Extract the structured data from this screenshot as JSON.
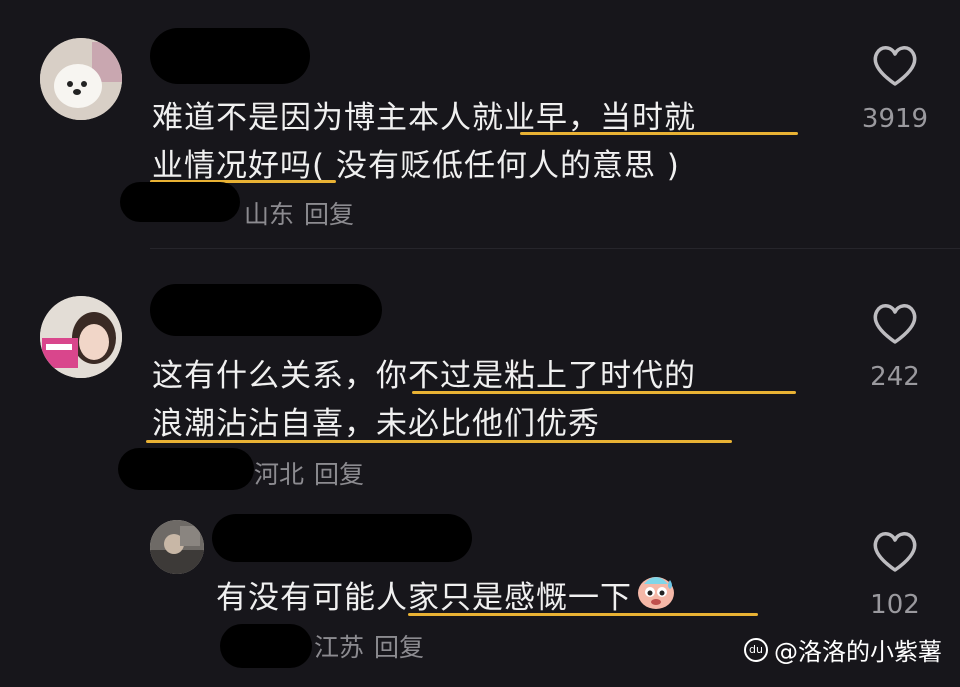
{
  "comments": [
    {
      "text_line1": "难道不是因为博主本人就业早，当时就",
      "text_line2": "业情况好吗( 没有贬低任何人的意思 )",
      "location": "山东",
      "reply": "回复",
      "likes": "3919"
    },
    {
      "text_line1": "这有什么关系，你不过是粘上了时代的",
      "text_line2": "浪潮沾沾自喜，未必比他们优秀",
      "location": "河北",
      "reply": "回复",
      "likes": "242"
    },
    {
      "text_line1": "有没有可能人家只是感慨一下",
      "location": "江苏",
      "reply": "回复",
      "likes": "102",
      "emoji": "sweat-face-emoji"
    }
  ],
  "watermark": {
    "text": "@洛洛的小紫薯",
    "logo": "du"
  },
  "colors": {
    "background": "#17161b",
    "underline": "#e9b234",
    "meta": "#8c8b90"
  }
}
